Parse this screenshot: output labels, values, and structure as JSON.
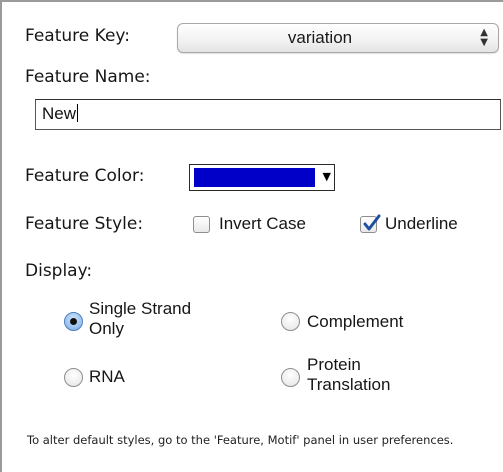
{
  "feature_key": {
    "label": "Feature Key:",
    "value": "variation",
    "stepper_icon": "up-down-arrows-icon"
  },
  "feature_name": {
    "label": "Feature Name:",
    "value": "New"
  },
  "feature_color": {
    "label": "Feature Color:",
    "swatch_color": "#0000c8",
    "dropdown_icon": "triangle-down-icon"
  },
  "feature_style": {
    "label": "Feature Style:",
    "invert_case": {
      "label": "Invert Case",
      "checked": false
    },
    "underline": {
      "label": "Underline",
      "checked": true
    }
  },
  "display": {
    "label": "Display:",
    "options": [
      {
        "line1": "Single Strand",
        "line2": "Only",
        "selected": true
      },
      {
        "line1": "Complement",
        "line2": "",
        "selected": false
      },
      {
        "line1": "RNA",
        "line2": "",
        "selected": false
      },
      {
        "line1": "Protein",
        "line2": "Translation",
        "selected": false
      }
    ]
  },
  "footnote": "To alter default styles, go to the 'Feature, Motif' panel in user preferences.",
  "colors": {
    "checkmark": "#1f4fa0",
    "radio_selected": "#9cc4ef"
  }
}
